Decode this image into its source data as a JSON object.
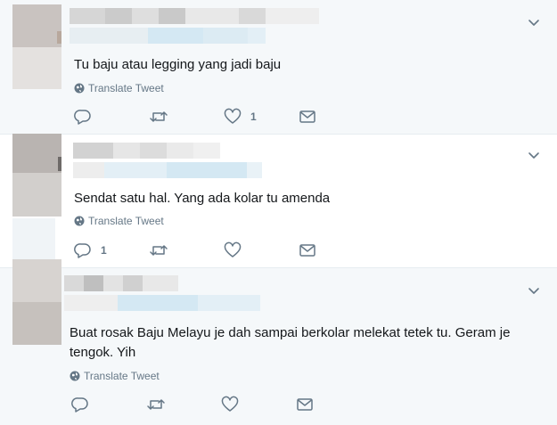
{
  "tweets": [
    {
      "text": "Tu baju atau legging yang jadi baju",
      "translate": "Translate Tweet",
      "actions": {
        "reply_count": "",
        "retweet_count": "",
        "like_count": "1"
      }
    },
    {
      "text": "Sendat satu hal. Yang ada kolar tu amenda",
      "translate": "Translate Tweet",
      "actions": {
        "reply_count": "1",
        "retweet_count": "",
        "like_count": ""
      }
    },
    {
      "text_line1": "Buat rosak Baju Melayu je dah sampai berkolar melekat tetek tu. Geram je",
      "text_line2": "tengok. Yih",
      "translate": "Translate Tweet",
      "actions": {
        "reply_count": "",
        "retweet_count": "",
        "like_count": ""
      }
    }
  ],
  "icons": {
    "reply": "reply-icon",
    "retweet": "retweet-icon",
    "like": "heart-icon",
    "dm": "envelope-icon",
    "globe": "globe-icon",
    "caret": "chevron-down-icon"
  },
  "colors": {
    "icon_gray": "#657786",
    "text": "#14171a",
    "hover_bg": "#f5f8fa",
    "border": "#e6ecf0",
    "blur_blue": "#d4e8f3"
  }
}
